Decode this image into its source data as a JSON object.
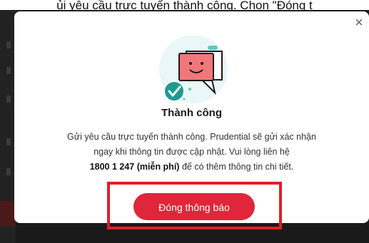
{
  "page": {
    "top_caption": "ủi yêu cầu trực tuyến thành công. Chọn \"Đóng t"
  },
  "modal": {
    "close_glyph": "×",
    "illustration_icon": "success-chat-icon",
    "title": "Thành công",
    "body_line1": "Gửi yêu cầu trực tuyến thành công. Prudential sẽ gửi xác nhận",
    "body_line2": "ngay khi thông tin được cập nhật. Vui lòng liên hệ",
    "hotline": "1800 1 247 (miễn phí)",
    "body_line3_suffix": " để có thêm thông tin chi tiết.",
    "button_label": "Đóng thông báo"
  },
  "colors": {
    "accent_red": "#e0263a",
    "highlight_frame": "#e21e26",
    "check_teal": "#1f9a8f",
    "bubble_pink": "#f2777a",
    "circle_bg": "#eaf6f7"
  }
}
